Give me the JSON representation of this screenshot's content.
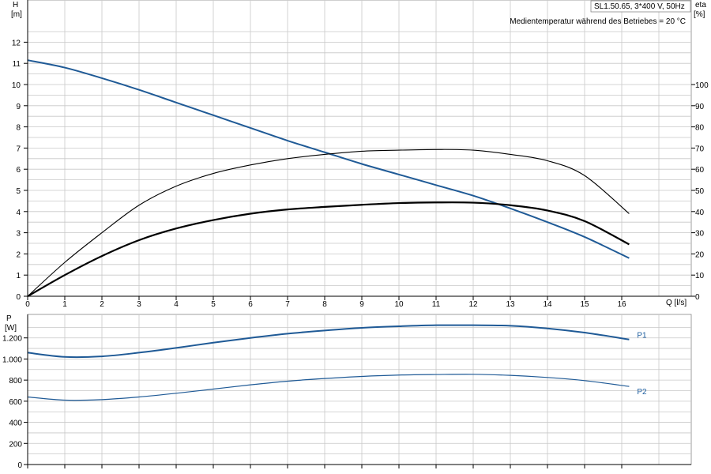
{
  "title": "SL1.50.65, 3*400 V, 50Hz",
  "subtitle": "Medientemperatur während des Betriebes = 20 °C",
  "colors": {
    "head": "#1f5a96",
    "power": "#1f5a96",
    "eta": "#000000",
    "grid": "#c8c8c8"
  },
  "chart_data": [
    {
      "type": "line",
      "xlabel": "Q [l/s]",
      "ylabel_left": "H\n[m]",
      "ylabel_right": "eta\n[%]",
      "xlim": [
        0,
        17
      ],
      "xticks": [
        0,
        1,
        2,
        3,
        4,
        5,
        6,
        7,
        8,
        9,
        10,
        11,
        12,
        13,
        14,
        15,
        16
      ],
      "ylim_left": [
        0,
        13
      ],
      "yticks_left": [
        0,
        1,
        2,
        3,
        4,
        5,
        6,
        7,
        8,
        9,
        10,
        11,
        12
      ],
      "ylim_right": [
        0,
        130
      ],
      "yticks_right": [
        0,
        10,
        20,
        30,
        40,
        50,
        60,
        70,
        80,
        90,
        100
      ],
      "grid": true,
      "series": [
        {
          "axis": "left",
          "x": [
            0,
            1,
            2,
            3,
            4,
            5,
            6,
            7,
            8,
            9,
            10,
            11,
            12,
            13,
            14,
            15,
            16.2
          ],
          "values": [
            11.15,
            10.8,
            10.3,
            9.75,
            9.15,
            8.55,
            7.95,
            7.35,
            6.8,
            6.25,
            5.75,
            5.25,
            4.75,
            4.15,
            3.5,
            2.8,
            1.8
          ]
        },
        {
          "axis": "right",
          "x": [
            0,
            1,
            2,
            3,
            4,
            5,
            6,
            7,
            8,
            9,
            10,
            11,
            12,
            13,
            14,
            15,
            16.2
          ],
          "values": [
            0,
            16,
            30,
            43,
            52,
            58,
            62,
            65,
            67,
            68.5,
            69,
            69.3,
            69,
            67,
            64,
            57,
            39
          ]
        },
        {
          "axis": "right",
          "x": [
            0,
            1,
            2,
            3,
            4,
            5,
            6,
            7,
            8,
            9,
            10,
            11,
            12,
            13,
            14,
            15,
            16.2
          ],
          "values": [
            0,
            10,
            19,
            26.5,
            32,
            36,
            39,
            41,
            42.2,
            43.2,
            44,
            44.3,
            44.2,
            43,
            40.5,
            35.5,
            24.5
          ]
        }
      ]
    },
    {
      "type": "line",
      "ylabel": "P\n[W]",
      "xlim": [
        0,
        17
      ],
      "ylim": [
        0,
        1400
      ],
      "yticks": [
        0,
        200,
        400,
        600,
        800,
        1000,
        1200
      ],
      "ytick_labels": [
        "0",
        "200",
        "400",
        "600",
        "800",
        "1.000",
        "1.200"
      ],
      "grid": true,
      "series": [
        {
          "name": "P1",
          "x": [
            0,
            1,
            2,
            3,
            4,
            5,
            6,
            7,
            8,
            9,
            10,
            11,
            12,
            13,
            14,
            15,
            16.2
          ],
          "values": [
            1060,
            1020,
            1025,
            1060,
            1105,
            1155,
            1200,
            1240,
            1270,
            1295,
            1310,
            1320,
            1320,
            1315,
            1290,
            1250,
            1185
          ]
        },
        {
          "name": "P2",
          "x": [
            0,
            1,
            2,
            3,
            4,
            5,
            6,
            7,
            8,
            9,
            10,
            11,
            12,
            13,
            14,
            15,
            16.2
          ],
          "values": [
            640,
            610,
            615,
            640,
            675,
            715,
            755,
            790,
            815,
            835,
            848,
            853,
            855,
            845,
            825,
            795,
            740
          ]
        }
      ]
    }
  ]
}
